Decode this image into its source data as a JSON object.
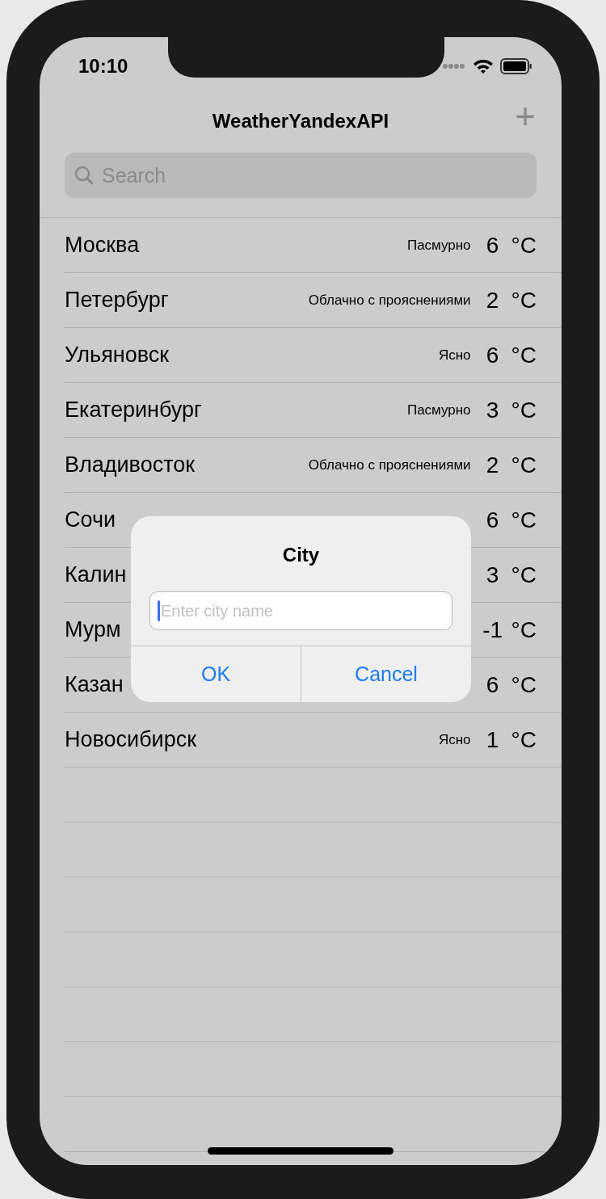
{
  "status_bar": {
    "time": "10:10"
  },
  "nav": {
    "title": "WeatherYandexAPI",
    "add_button": "+"
  },
  "search": {
    "placeholder": "Search"
  },
  "cities": [
    {
      "name": "Москва",
      "condition": "Пасмурно",
      "temp": "6",
      "unit": "°C"
    },
    {
      "name": "Петербург",
      "condition": "Облачно с прояснениями",
      "temp": "2",
      "unit": "°C"
    },
    {
      "name": "Ульяновск",
      "condition": "Ясно",
      "temp": "6",
      "unit": "°C"
    },
    {
      "name": "Екатеринбург",
      "condition": "Пасмурно",
      "temp": "3",
      "unit": "°C"
    },
    {
      "name": "Владивосток",
      "condition": "Облачно с прояснениями",
      "temp": "2",
      "unit": "°C"
    },
    {
      "name": "Сочи",
      "temp": "6",
      "unit": "°C"
    },
    {
      "name": "Калин",
      "temp": "3",
      "unit": "°C"
    },
    {
      "name": "Мурм",
      "temp": "-1",
      "unit": "°C"
    },
    {
      "name": "Казан",
      "temp": "6",
      "unit": "°C"
    },
    {
      "name": "Новосибирск",
      "condition": "Ясно",
      "temp": "1",
      "unit": "°C"
    }
  ],
  "alert": {
    "title": "City",
    "field": {
      "placeholder": "Enter city name"
    },
    "buttons": [
      "OK",
      "Cancel"
    ]
  }
}
